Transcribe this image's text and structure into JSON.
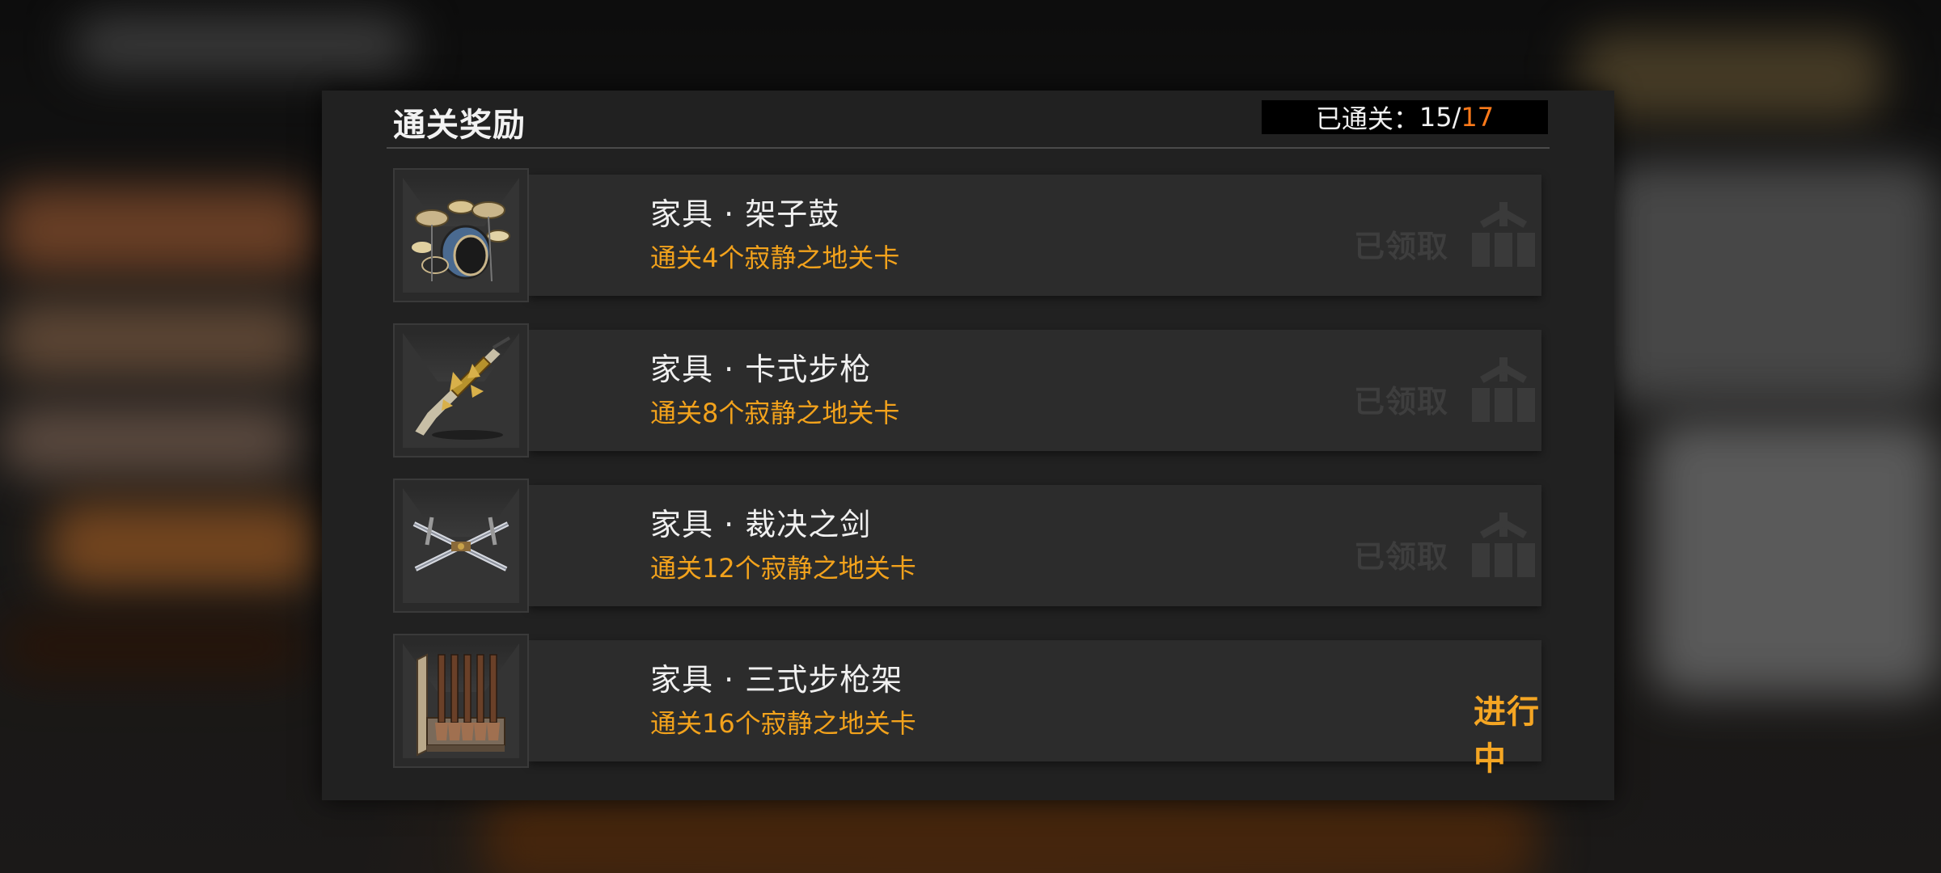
{
  "panel": {
    "title": "通关奖励",
    "progress_label": "已通关：",
    "progress_current": "15/",
    "progress_total": "17"
  },
  "colors": {
    "accent_orange": "#f2a21c",
    "progress_total": "#ff7a1a",
    "claimed_gray": "#3e3e3e"
  },
  "rewards": [
    {
      "name": "家具 · 架子鼓",
      "requirement": "通关4个寂静之地关卡",
      "icon": "drum-kit-icon",
      "status": "已领取"
    },
    {
      "name": "家具 · 卡式步枪",
      "requirement": "通关8个寂静之地关卡",
      "icon": "rifle-icon",
      "status": "已领取"
    },
    {
      "name": "家具 · 裁决之剑",
      "requirement": "通关12个寂静之地关卡",
      "icon": "crossed-swords-icon",
      "status": "已领取"
    },
    {
      "name": "家具 · 三式步枪架",
      "requirement": "通关16个寂静之地关卡",
      "icon": "rifle-rack-icon",
      "status": "进行中"
    }
  ]
}
